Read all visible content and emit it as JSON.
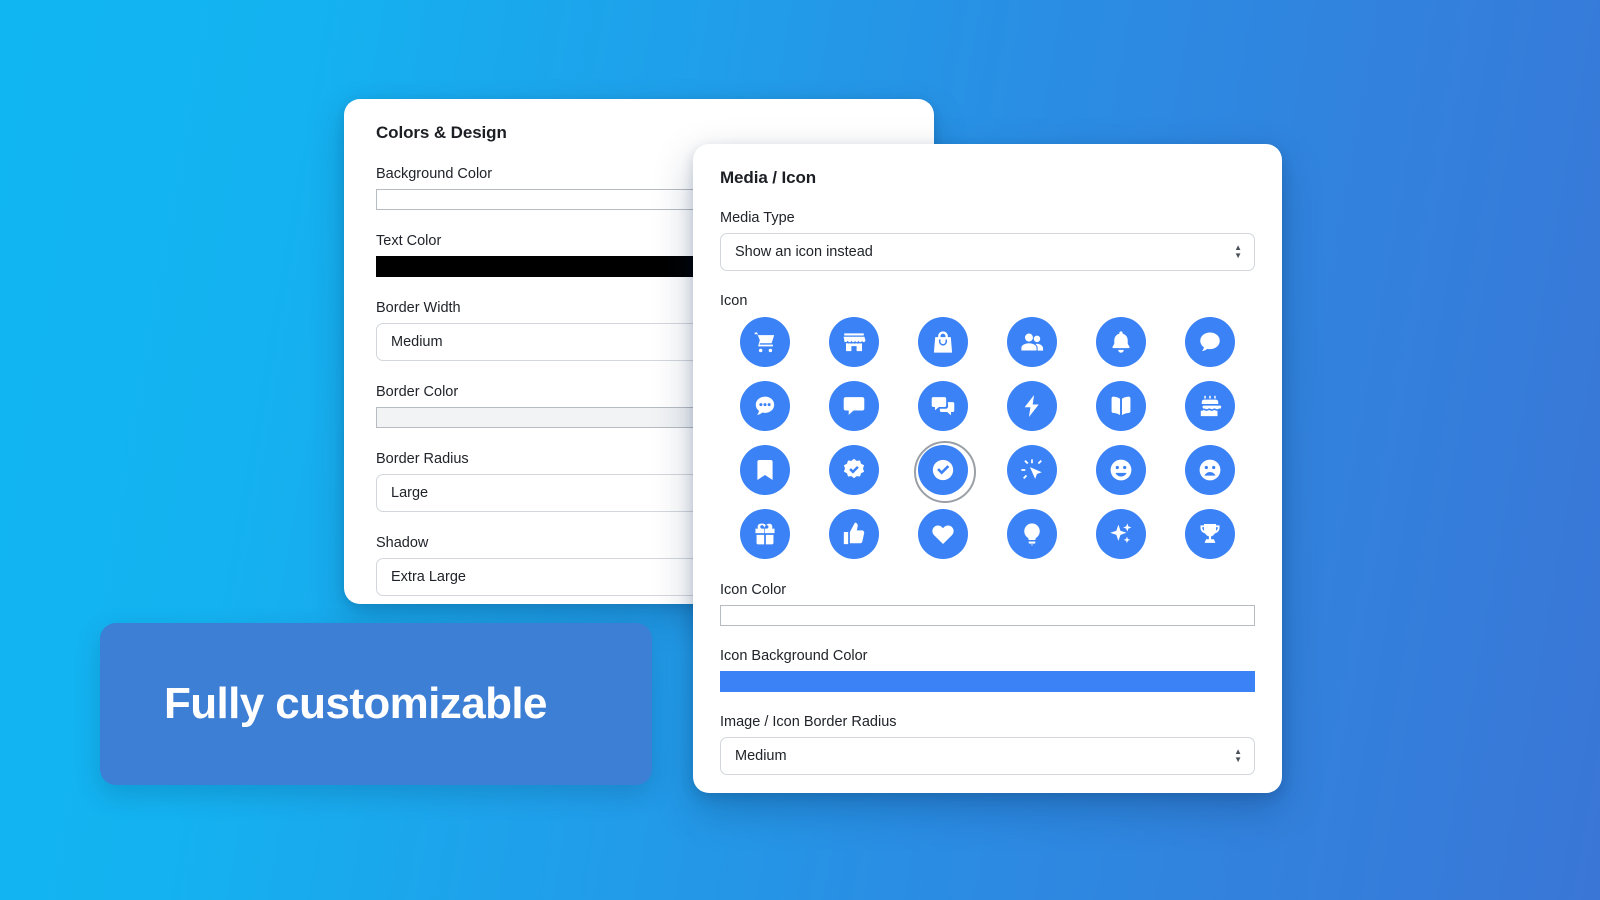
{
  "background": {
    "gradient_from": "#10b6f2",
    "gradient_to": "#3a76d6"
  },
  "left_panel": {
    "title": "Colors & Design",
    "fields": [
      {
        "label": "Background Color",
        "type": "color",
        "value": "#ffffff",
        "swatch": "white"
      },
      {
        "label": "Text Color",
        "type": "color",
        "value": "#000000",
        "swatch": "black"
      },
      {
        "label": "Border Width",
        "type": "select",
        "value": "Medium"
      },
      {
        "label": "Border Color",
        "type": "color",
        "value": "#f1f3f5",
        "swatch": "grey"
      },
      {
        "label": "Border Radius",
        "type": "select",
        "value": "Large"
      },
      {
        "label": "Shadow",
        "type": "select",
        "value": "Extra Large"
      }
    ]
  },
  "right_panel": {
    "title": "Media / Icon",
    "media_type": {
      "label": "Media Type",
      "value": "Show an icon instead"
    },
    "icon_section": {
      "label": "Icon",
      "selected_index": 14,
      "icons": [
        {
          "name": "shopping-cart-icon"
        },
        {
          "name": "store-icon"
        },
        {
          "name": "shopping-bag-icon"
        },
        {
          "name": "users-icon"
        },
        {
          "name": "bell-icon"
        },
        {
          "name": "chat-bubble-icon"
        },
        {
          "name": "chat-dots-circle-icon"
        },
        {
          "name": "chat-dots-square-icon"
        },
        {
          "name": "chats-stacked-icon"
        },
        {
          "name": "lightning-bolt-icon"
        },
        {
          "name": "open-book-icon"
        },
        {
          "name": "cake-icon"
        },
        {
          "name": "bookmark-icon"
        },
        {
          "name": "badge-check-icon"
        },
        {
          "name": "check-circle-icon"
        },
        {
          "name": "click-cursor-icon"
        },
        {
          "name": "smiley-happy-icon"
        },
        {
          "name": "smiley-sad-icon"
        },
        {
          "name": "gift-icon"
        },
        {
          "name": "thumbs-up-icon"
        },
        {
          "name": "heart-icon"
        },
        {
          "name": "lightbulb-icon"
        },
        {
          "name": "sparkles-icon"
        },
        {
          "name": "trophy-icon"
        }
      ]
    },
    "icon_color": {
      "label": "Icon Color",
      "value": "#ffffff"
    },
    "icon_background_color": {
      "label": "Icon Background Color",
      "value": "#3b82f6"
    },
    "image_icon_border_radius": {
      "label": "Image / Icon Border Radius",
      "value": "Medium"
    }
  },
  "banner": {
    "text": "Fully customizable",
    "background_color": "#3d7fd4",
    "text_color": "#ffffff"
  }
}
